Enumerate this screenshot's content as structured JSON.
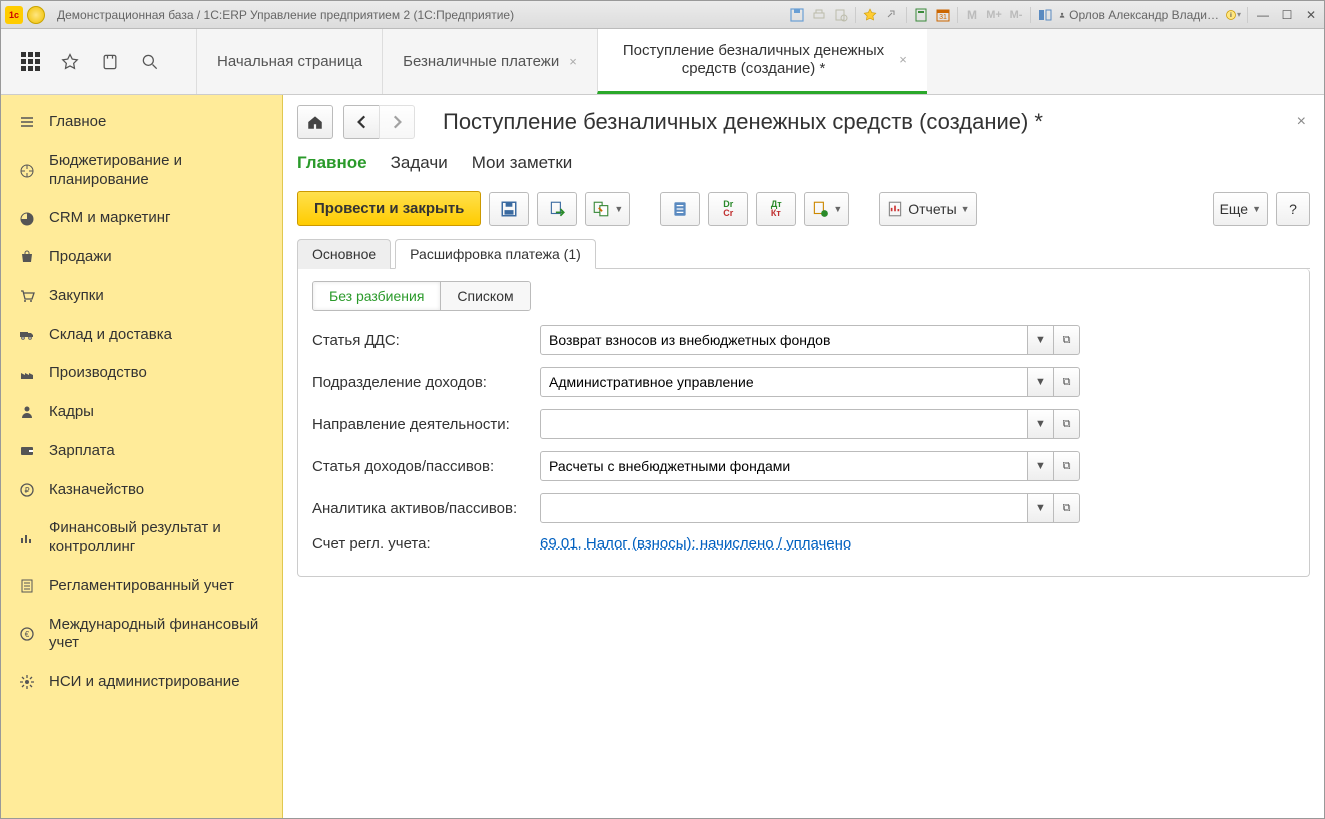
{
  "titlebar": {
    "title": "Демонстрационная база / 1С:ERP Управление предприятием 2  (1С:Предприятие)",
    "user": "Орлов Александр Влади…"
  },
  "top_tabs": {
    "t0": "Начальная страница",
    "t1": "Безналичные платежи",
    "t2": "Поступление безналичных денежных средств (создание) *"
  },
  "sidebar": {
    "items": [
      "Главное",
      "Бюджетирование и планирование",
      "CRM и маркетинг",
      "Продажи",
      "Закупки",
      "Склад и доставка",
      "Производство",
      "Кадры",
      "Зарплата",
      "Казначейство",
      "Финансовый результат и контроллинг",
      "Регламентированный учет",
      "Международный финансовый учет",
      "НСИ и администрирование"
    ]
  },
  "page": {
    "title": "Поступление безналичных денежных средств (создание) *",
    "sub_tabs": {
      "t0": "Главное",
      "t1": "Задачи",
      "t2": "Мои заметки"
    },
    "toolbar": {
      "primary": "Провести и закрыть",
      "reports": "Отчеты",
      "more": "Еще",
      "help": "?"
    },
    "card_tabs": {
      "t0": "Основное",
      "t1": "Расшифровка платежа (1)"
    },
    "mode_tabs": {
      "t0": "Без разбиения",
      "t1": "Списком"
    },
    "form": {
      "dds": {
        "label": "Статья ДДС:",
        "value": "Возврат взносов из внебюджетных фондов"
      },
      "dept": {
        "label": "Подразделение доходов:",
        "value": "Административное управление"
      },
      "direction": {
        "label": "Направление деятельности:",
        "value": ""
      },
      "income": {
        "label": "Статья доходов/пассивов:",
        "value": "Расчеты с внебюджетными фондами"
      },
      "analytics": {
        "label": "Аналитика активов/пассивов:",
        "value": ""
      },
      "account": {
        "label": "Счет регл. учета:",
        "link": "69.01, Налог (взносы): начислено / уплачено"
      }
    }
  }
}
